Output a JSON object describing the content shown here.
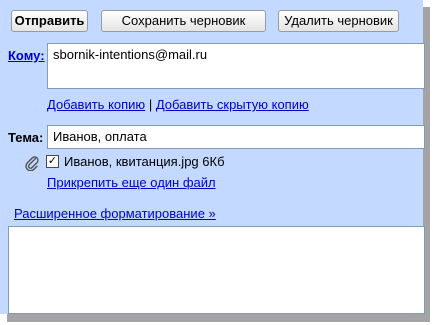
{
  "toolbar": {
    "send_label": "Отправить",
    "save_draft_label": "Сохранить черновик",
    "delete_draft_label": "Удалить черновик"
  },
  "to": {
    "label": "Кому:",
    "value": "sbornik-intentions@mail.ru"
  },
  "recipients_links": {
    "add_copy": "Добавить копию",
    "separator": "|",
    "add_hidden_copy": "Добавить скрытую копию"
  },
  "subject": {
    "label": "Тема:",
    "value": "Иванов, оплата"
  },
  "attachment": {
    "icon": "paperclip-icon",
    "checked": true,
    "checkmark": "✓",
    "filename": "Иванов, квитанция.jpg",
    "size": "6Кб",
    "attach_another": "Прикрепить еще один файл"
  },
  "advanced_formatting": "Расширенное форматирование »",
  "colors": {
    "panel": "#c3d9ff",
    "link": "#0000cc",
    "field_border": "#7f9db9"
  }
}
